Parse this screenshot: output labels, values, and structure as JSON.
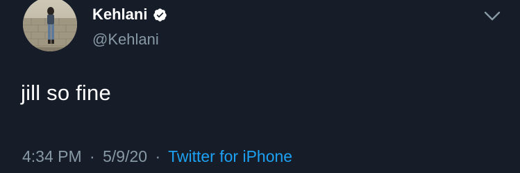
{
  "author": {
    "name": "Kehlani",
    "handle": "@Kehlani",
    "verified": true
  },
  "tweet": {
    "text": "jill so fine"
  },
  "meta": {
    "time": "4:34 PM",
    "separator": "·",
    "date": "5/9/20",
    "source": "Twitter for iPhone"
  },
  "icons": {
    "verified": "verified-badge-icon",
    "menu": "chevron-down-icon"
  },
  "colors": {
    "background": "#161d28",
    "name": "#ffffff",
    "secondary": "#8899a6",
    "link": "#1da1f2",
    "verified_badge": "#ffffff"
  }
}
